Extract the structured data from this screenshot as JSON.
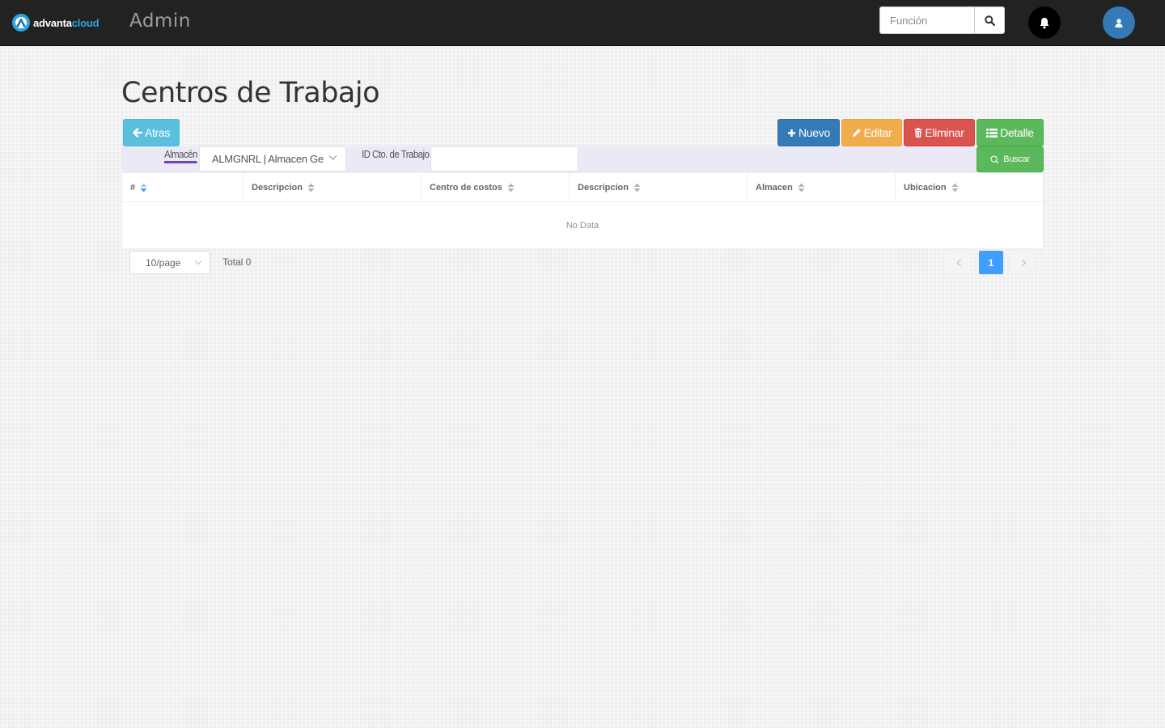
{
  "header": {
    "logo_text_primary": "advanta",
    "logo_text_secondary": "cloud",
    "app_title": "Admin",
    "search_placeholder": "Función",
    "search_icon": "search-icon",
    "bell_icon": "bell-icon",
    "user_icon": "user-icon"
  },
  "page": {
    "title": "Centros de Trabajo"
  },
  "toolbar": {
    "back_label": "Atras",
    "new_label": "Nuevo",
    "edit_label": "Editar",
    "delete_label": "Eliminar",
    "detail_label": "Detalle",
    "search_label": "Buscar"
  },
  "filters": {
    "almacen_label": "Almacén",
    "almacen_value": "ALMGNRL | Almacen General",
    "idcto_label": "ID Cto. de Trabajo",
    "idcto_value": ""
  },
  "table": {
    "columns": [
      "#",
      "Descripcion",
      "Centro de costos",
      "Descripcion",
      "Almacen",
      "Ubicacion"
    ],
    "rows": [],
    "empty_text": "No Data"
  },
  "pagination": {
    "page_size": "10/page",
    "total_text": "Total 0",
    "current_page": "1"
  },
  "colors": {
    "topbar": "#222222",
    "primary": "#337ab7",
    "info": "#5bc0de",
    "warning": "#f0ad4e",
    "danger": "#d9534f",
    "success": "#5cb85c",
    "filter_bar": "#ebe9f5",
    "active_page": "#409eff",
    "brand_accent": "#29a8df"
  }
}
